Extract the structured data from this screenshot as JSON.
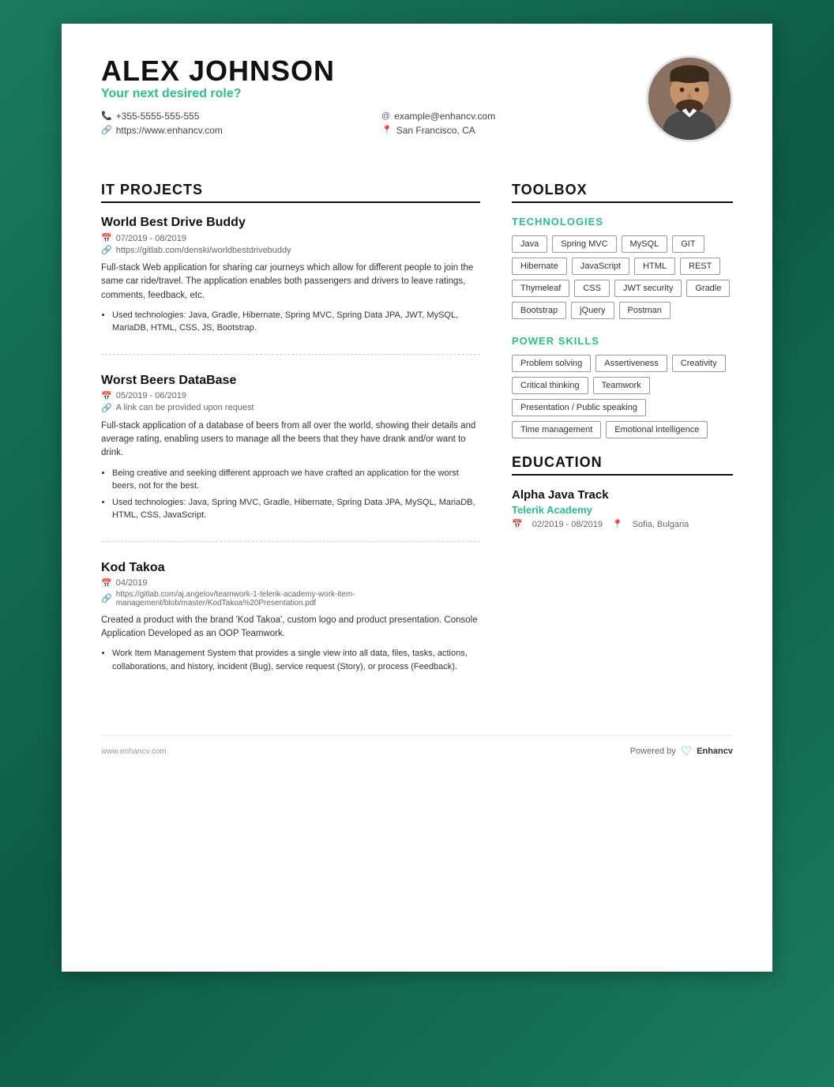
{
  "header": {
    "name": "ALEX JOHNSON",
    "desired_role": "Your next desired role?",
    "phone": "+355-5555-555-555",
    "website": "https://www.enhancv.com",
    "email": "example@enhancv.com",
    "location": "San Francisco, CA"
  },
  "it_projects": {
    "title": "IT PROJECTS",
    "projects": [
      {
        "title": "World Best Drive Buddy",
        "dates": "07/2019 - 08/2019",
        "link": "https://gitlab.com/denski/worldbestdrivebuddy",
        "description": "Full-stack Web application for sharing car journeys which allow for different people to join the same car ride/travel. The application enables both passengers and drivers to leave ratings, comments, feedback, etc.",
        "bullets": [
          "Used technologies: Java, Gradle, Hibernate, Spring MVC, Spring Data JPA, JWT, MySQL, MariaDB, HTML, CSS, JS, Bootstrap."
        ]
      },
      {
        "title": "Worst Beers DataBase",
        "dates": "05/2019 - 06/2019",
        "link": "A link can be provided upon request",
        "description": "Full-stack application of a database of beers from all over the world, showing their details and average rating, enabling users to manage all the beers that they have drank and/or want to drink.",
        "bullets": [
          "Being creative and seeking different approach we have crafted an application for the worst beers, not for the best.",
          "Used technologies: Java, Spring MVC, Gradle, Hibernate, Spring Data JPA, MySQL, MariaDB, HTML, CSS, JavaScript."
        ]
      },
      {
        "title": "Kod Takoa",
        "dates": "04/2019",
        "link": "https://gitlab.com/aj.angelov/teamwork-1-telerik-academy-work-item-management/blob/master/KodTakoa%20Presentation.pdf",
        "description": "Created a product with the brand 'Kod Takoa', custom logo and product presentation. Console Application Developed as an OOP Teamwork.",
        "bullets": [
          "Work Item Management System that provides a single view into all data, files, tasks, actions, collaborations, and history, incident (Bug), service request (Story), or process (Feedback)."
        ]
      }
    ]
  },
  "toolbox": {
    "title": "TOOLBOX",
    "technologies": {
      "subtitle": "TECHNOLOGIES",
      "tags": [
        "Java",
        "Spring MVC",
        "MySQL",
        "GIT",
        "Hibernate",
        "JavaScript",
        "HTML",
        "REST",
        "Thymeleaf",
        "CSS",
        "JWT security",
        "Gradle",
        "Bootstrap",
        "jQuery",
        "Postman"
      ]
    },
    "power_skills": {
      "subtitle": "POWER SKILLS",
      "tags": [
        "Problem solving",
        "Assertiveness",
        "Creativity",
        "Critical thinking",
        "Teamwork",
        "Presentation / Public speaking",
        "Time management",
        "Emotional intelligence"
      ]
    }
  },
  "education": {
    "title": "EDUCATION",
    "school_name": "Alpha Java Track",
    "school_org": "Telerik Academy",
    "dates": "02/2019 - 08/2019",
    "location": "Sofia, Bulgaria"
  },
  "footer": {
    "website": "www.enhancv.com",
    "powered_by": "Powered by",
    "brand": "Enhancv"
  }
}
